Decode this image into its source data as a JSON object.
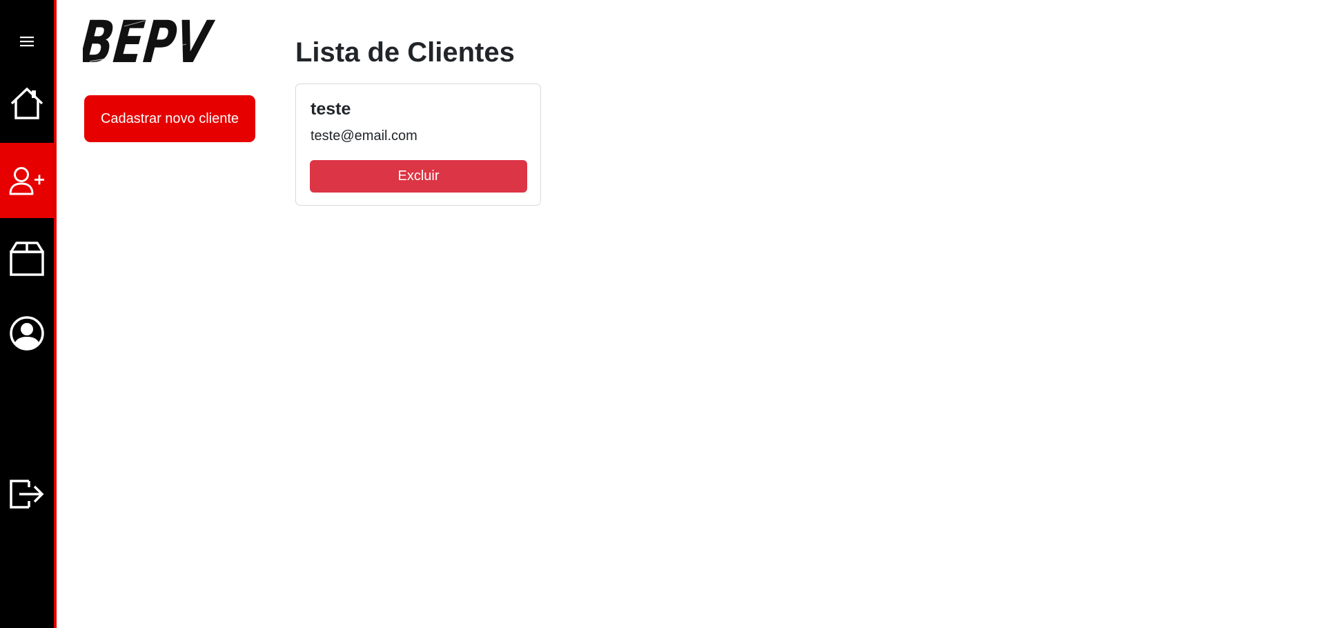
{
  "brand": {
    "logo_text": "BEPV"
  },
  "sidebar": {
    "items": [
      {
        "icon": "menu-icon",
        "active": false
      },
      {
        "icon": "home-icon",
        "active": false
      },
      {
        "icon": "add-user-icon",
        "active": true
      },
      {
        "icon": "box-icon",
        "active": false
      },
      {
        "icon": "user-circle-icon",
        "active": false
      },
      {
        "icon": "logout-icon",
        "active": false
      }
    ],
    "background_color": "#000000",
    "accent_color": "#e60000"
  },
  "actions": {
    "new_client_label": "Cadastrar novo cliente"
  },
  "main": {
    "title": "Lista de Clientes",
    "clients": [
      {
        "name": "teste",
        "email": "teste@email.com",
        "delete_label": "Excluir"
      }
    ]
  },
  "colors": {
    "primary_red": "#e60000",
    "danger": "#dc3545",
    "text": "#212529"
  }
}
